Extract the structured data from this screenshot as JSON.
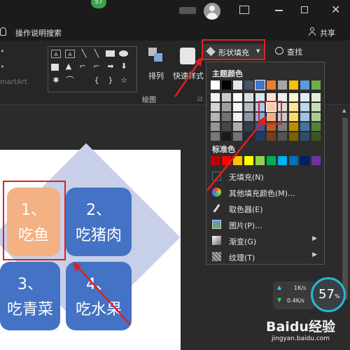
{
  "titlebar": {
    "badge": "57",
    "user": "■■",
    "restore_icon": "restore-window-icon"
  },
  "tellbar": {
    "search_label": "操作说明搜索",
    "share_label": "共享"
  },
  "ribbon": {
    "group_label_drawing": "绘图",
    "arrange_label": "排列",
    "quick_styles_label": "快速样式",
    "smartart_label": "martArt",
    "shape_fill_label": "形状填充",
    "find_label": "查找"
  },
  "dropdown": {
    "theme_colors_title": "主题颜色",
    "standard_colors_title": "标准色",
    "no_fill": "无填充(N)",
    "more_colors": "其他填充颜色(M)...",
    "eyedropper": "取色器(E)",
    "picture": "图片(P)...",
    "gradient": "渐变(G)",
    "texture": "纹理(T)",
    "theme_top_row": [
      "#ffffff",
      "#000000",
      "#e7e6e6",
      "#44546a",
      "#4472c4",
      "#ed7d31",
      "#a5a5a5",
      "#ffc000",
      "#5b9bd5",
      "#70ad47"
    ],
    "standard_row": [
      "#c00000",
      "#ff0000",
      "#ffc000",
      "#ffff00",
      "#92d050",
      "#00b050",
      "#00b0f0",
      "#0070c0",
      "#002060",
      "#7030a0"
    ]
  },
  "slide": {
    "cards": [
      {
        "num": "1、",
        "text": "吃鱼",
        "color": "#f4b183"
      },
      {
        "num": "2、",
        "text": "吃猪肉",
        "color": "#4472c4"
      },
      {
        "num": "3、",
        "text": "吃青菜",
        "color": "#4472c4"
      },
      {
        "num": "4、",
        "text": "吃水果",
        "color": "#4472c4"
      }
    ]
  },
  "netmon": {
    "up": "1K/s",
    "down": "0.4K/s",
    "percent": "57",
    "percent_unit": "%"
  },
  "watermark": {
    "brand": "Baidu经验",
    "url": "jingyan.baidu.com"
  }
}
